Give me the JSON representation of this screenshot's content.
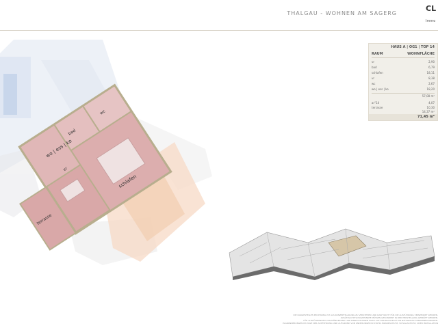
{
  "header": {
    "title": "THALGAU - WOHNEN AM SAGERG",
    "logo_text": "CL",
    "logo_subtext": "Immo"
  },
  "area_table": {
    "heading": "HAUS A | OG1 | TOP 14",
    "col_room": "RAUM",
    "col_area": "WOHNFLÄCHE",
    "rows": [
      {
        "label": "vr",
        "value": "2,90"
      },
      {
        "label": "bad",
        "value": "6,79"
      },
      {
        "label": "schlafen",
        "value": "18,11"
      },
      {
        "label": "vr",
        "value": "8,38"
      },
      {
        "label": "wc",
        "value": "2,67"
      },
      {
        "label": "wo | ess | ko",
        "value": "18,20"
      }
    ],
    "subtotal_living": "57,08 m²",
    "extras": [
      {
        "label": "ar°14",
        "value": "4,07"
      },
      {
        "label": "terrasse",
        "value": "10,30"
      }
    ],
    "subtotal_extras": "14,37 m²",
    "total": "71,45 m²"
  },
  "plan_labels": {
    "living": "wo | ess | ko",
    "bedroom": "schlafen",
    "terrace": "terrasse",
    "bath": "bad",
    "wc": "wc",
    "hall": "vr"
  },
  "disclaimer": [
    "DIE DARGESTELLTE ZEICHNUNG IST ALS KONZEPTPLANUNG ZU VERSTEHEN UND DARF NICHT FÜR DIE AUSFÜHRUNG VERWENDET WERDEN.",
    "ZUSÄTZLICHE SCHALTPUNKTE MÜSSEN GESONDERT IN DER HERSTELLUNG GEPRÜFT WERDEN.",
    "FÜR AUSFÜHRUNGEN VON MÖBLIERUNG UND EINRICHTUNGEN MUSS AUF DER BAUSTELLE EIN NATURMASS GENOMMEN WERDEN.",
    "PLANÄNDERUNGEN IM ZUGE DER AUSFÜHRUNG UND AUFGRUND VON ÄNDERUNGEN IN STATIK, BRANDSCHUTZ, SCHALLSCHUTZ, ODER INSTALLATION"
  ],
  "colors": {
    "accent_pink": "#d9a8a8",
    "wall_khaki": "#b8ae8e",
    "orange_plan": "#f3cfb4",
    "blue_plan": "#c8d4ea"
  }
}
